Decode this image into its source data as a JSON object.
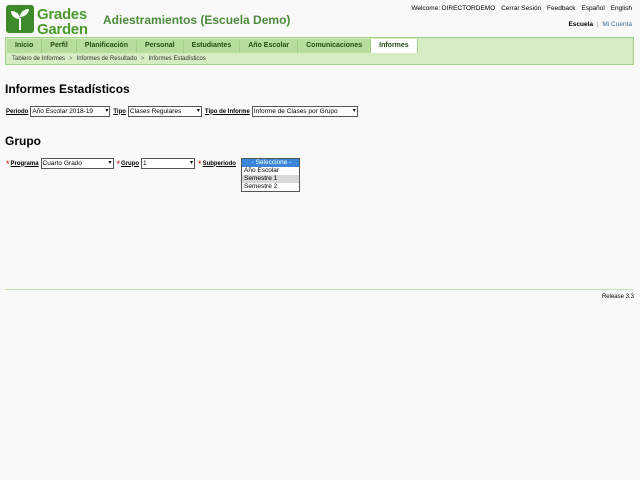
{
  "logo": {
    "line1": "Grades",
    "line2": "Garden"
  },
  "app_title": "Adiestramientos (Escuela Demo)",
  "top_links": {
    "welcome": "Welcome: DIRECTORDEMO",
    "logout": "Cerrar Sesión",
    "feedback": "Feedback",
    "spanish": "Español",
    "english": "English"
  },
  "context": {
    "school": "Escuela",
    "separator": "|",
    "my_account": "Mi Cuenta"
  },
  "nav": {
    "tabs": [
      "Inicio",
      "Perfil",
      "Planificación",
      "Personal",
      "Estudiantes",
      "Año Escolar",
      "Comunicaciones",
      "Informes"
    ],
    "active_tab": "Informes"
  },
  "breadcrumb": {
    "items": [
      "Tablero de Informes",
      "Informes de Resultado",
      "Informes Estadísticos"
    ],
    "separator": ">"
  },
  "page_title": "Informes Estadísticos",
  "filters": {
    "period": {
      "label": "Periodo",
      "value": "Año Escolar 2018-19"
    },
    "type": {
      "label": "Tipo",
      "value": "Clases Regulares"
    },
    "report_type": {
      "label": "Tipo de Informe",
      "value": "Informe de Clases por Grupo"
    }
  },
  "section_title": "Grupo",
  "group_filters": {
    "required_mark": "*",
    "program": {
      "label": "Programa",
      "value": "Cuarto Grado"
    },
    "group": {
      "label": "Grupo",
      "value": "1"
    },
    "subperiod": {
      "label": "Subperiodo"
    }
  },
  "subperiod_dropdown": {
    "options": [
      "- Seleccione -",
      "Año Escolar",
      "Semestre 1",
      "Semestre 2"
    ],
    "selected_index": 0,
    "hover_index": 2
  },
  "release": "Release 3.3",
  "colors": {
    "brand_green": "#4c9a2f",
    "nav_bg": "#d6ecc3",
    "tab_bg": "#b6dd9c",
    "required": "#cc0000",
    "selection": "#3b86d8"
  }
}
